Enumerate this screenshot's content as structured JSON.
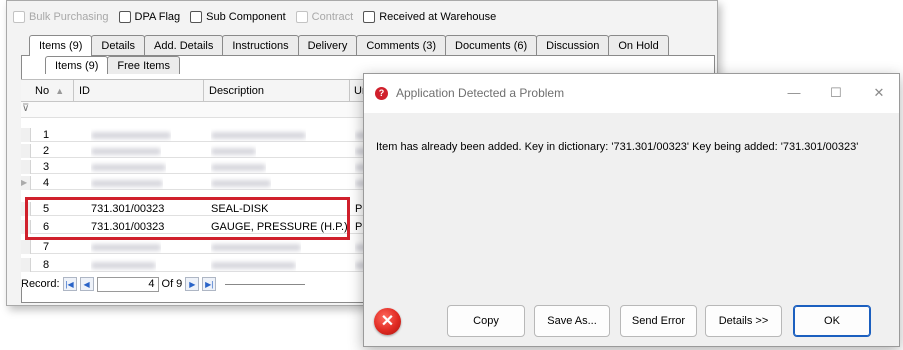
{
  "flags": [
    {
      "label": "Bulk Purchasing",
      "enabled": false
    },
    {
      "label": "DPA Flag",
      "enabled": true
    },
    {
      "label": "Sub Component",
      "enabled": true
    },
    {
      "label": "Contract",
      "enabled": false
    },
    {
      "label": "Received at Warehouse",
      "enabled": true
    }
  ],
  "tabs": [
    "Items (9)",
    "Details",
    "Add. Details",
    "Instructions",
    "Delivery",
    "Comments (3)",
    "Documents (6)",
    "Discussion",
    "On Hold"
  ],
  "subtabs": [
    "Items (9)",
    "Free Items"
  ],
  "grid": {
    "headers": {
      "no": "No",
      "id": "ID",
      "description": "Description",
      "unit": "Ur"
    },
    "rows": [
      {
        "no": "1",
        "id": "",
        "description": "",
        "unit": ""
      },
      {
        "no": "2",
        "id": "",
        "description": "",
        "unit": ""
      },
      {
        "no": "3",
        "id": "",
        "description": "",
        "unit": ""
      },
      {
        "no": "4",
        "id": "",
        "description": "",
        "unit": ""
      },
      {
        "no": "5",
        "id": "731.301/00323",
        "description": "SEAL-DISK",
        "unit": "PC"
      },
      {
        "no": "6",
        "id": "731.301/00323",
        "description": "GAUGE, PRESSURE (H.P.)",
        "unit": "PC"
      },
      {
        "no": "7",
        "id": "",
        "description": "",
        "unit": ""
      },
      {
        "no": "8",
        "id": "",
        "description": "",
        "unit": ""
      }
    ]
  },
  "nav": {
    "label": "Record:",
    "current": "4",
    "of_label": "Of",
    "total": "9"
  },
  "dialog": {
    "title": "Application Detected a Problem",
    "message": "Item has already been added. Key in dictionary: '731.301/00323'  Key being added: '731.301/00323'",
    "buttons": [
      "Copy",
      "Save As...",
      "Send Error",
      "Details >>",
      "OK"
    ],
    "window_controls": {
      "minimize": "—",
      "maximize": "☐",
      "close": "✕"
    },
    "accent": "#d0202c"
  }
}
